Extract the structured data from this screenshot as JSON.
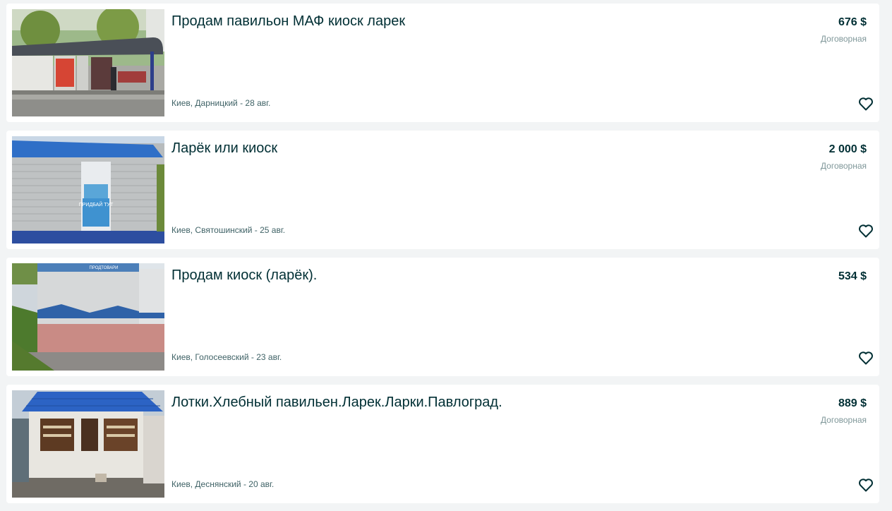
{
  "listings": [
    {
      "title": "Продам павильон МАФ киоск ларек",
      "price": "676 $",
      "negotiable": "Договорная",
      "location": "Киев, Дарницкий - 28 авг."
    },
    {
      "title": "Ларёк или киоск",
      "price": "2 000 $",
      "negotiable": "Договорная",
      "location": "Киев, Святошинский - 25 авг."
    },
    {
      "title": "Продам киоск (ларёк).",
      "price": "534 $",
      "negotiable": "",
      "location": "Киев, Голосеевский - 23 авг."
    },
    {
      "title": "Лотки.Хлебный павильен.Ларек.Ларки.Павлоград.",
      "price": "889 $",
      "negotiable": "Договорная",
      "location": "Киев, Деснянский - 20 авг."
    }
  ],
  "icons": {
    "favorite": "heart-outline-icon"
  },
  "colors": {
    "text": "#002f34",
    "muted": "#7f9799",
    "location": "#406367",
    "background": "#f2f4f5",
    "card": "#ffffff"
  },
  "thumbnail_text": {
    "kiosk2_sign": "ПРИДБАЙ ТУТ",
    "kiosk3_sign": "ПРОДТОВАРИ"
  }
}
